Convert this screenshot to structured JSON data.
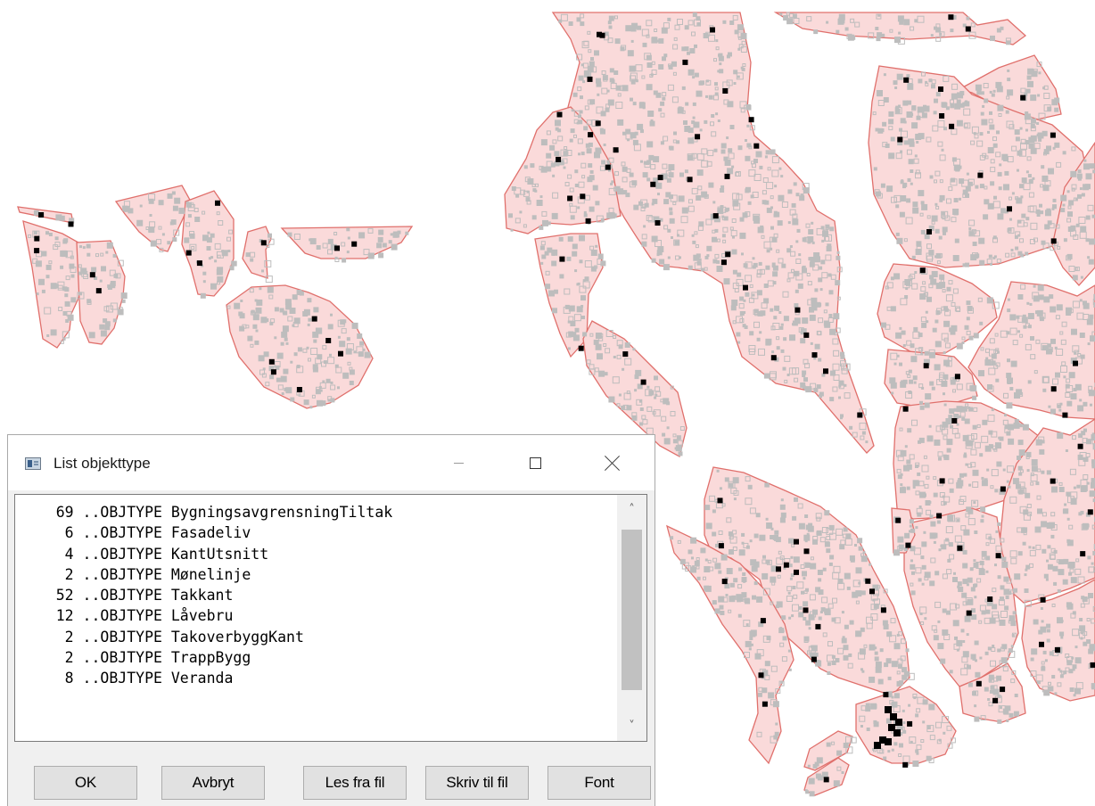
{
  "dialog": {
    "title": "List objekttype",
    "controls": {
      "minimize": "minimize",
      "maximize": "maximize",
      "close": "close"
    }
  },
  "list": {
    "items": [
      "    69 ..OBJTYPE BygningsavgrensningTiltak",
      "     6 ..OBJTYPE Fasadeliv",
      "     4 ..OBJTYPE KantUtsnitt",
      "     2 ..OBJTYPE Mønelinje",
      "    52 ..OBJTYPE Takkant",
      "    12 ..OBJTYPE Låvebru",
      "     2 ..OBJTYPE TakoverbyggKant",
      "     2 ..OBJTYPE TrappBygg",
      "     8 ..OBJTYPE Veranda"
    ],
    "scroll_up_glyph": "^",
    "scroll_down_glyph": "v"
  },
  "buttons": {
    "ok": "OK",
    "cancel": "Avbryt",
    "read_file": "Les fra fil",
    "write_file": "Skriv til fil",
    "font": "Font"
  },
  "map": {
    "fill_color": "#fadada",
    "outline_color": "#e0706c",
    "building_color": "#bdbdbd",
    "point_color": "#000000"
  }
}
